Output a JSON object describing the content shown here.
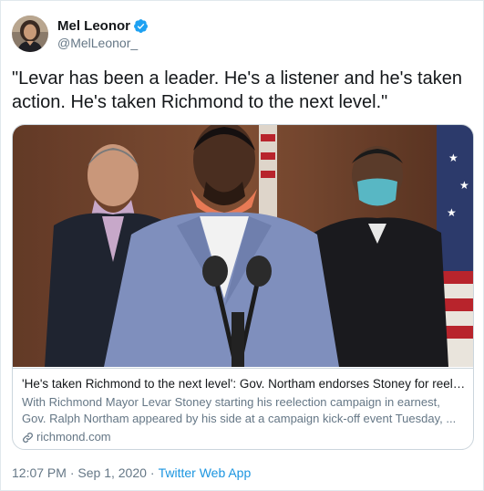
{
  "author": {
    "display_name": "Mel Leonor",
    "handle": "@MelLeonor_",
    "verified": true,
    "avatar_icon": "profile-photo"
  },
  "tweet": {
    "text": "\"Levar has been a leader. He's a listener and he's taken action. He's taken Richmond to the next level.\""
  },
  "card": {
    "title": "'He's taken Richmond to the next level': Gov. Northam endorses Stoney for reele...",
    "description": "With Richmond Mayor Levar Stoney starting his reelection campaign in earnest, Gov. Ralph Northam appeared by his side at a campaign kick-off event Tuesday, ...",
    "domain": "richmond.com",
    "image_icon": "press-conference-photo"
  },
  "meta": {
    "time": "12:07 PM",
    "date": "Sep 1, 2020",
    "separator": "·",
    "source": "Twitter Web App"
  },
  "colors": {
    "link": "#1b95e0",
    "secondary_text": "#657786",
    "border": "#ccd6dd",
    "verified": "#1da1f2"
  }
}
